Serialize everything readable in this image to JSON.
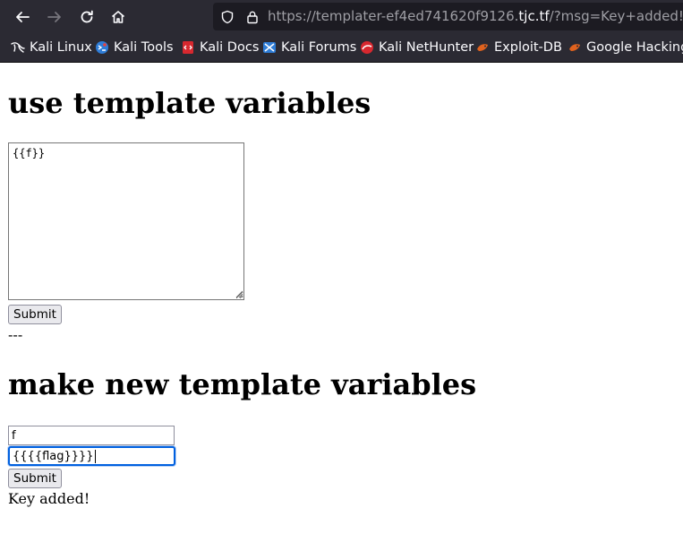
{
  "browser": {
    "url_prefix": "https://",
    "url_host_start": "templater-ef4ed741620f9126.",
    "url_host": "tjc.tf",
    "url_path": "/?msg=Key+added!",
    "bookmarks": [
      {
        "label": "Kali Linux",
        "icon": "kali-dragon-icon"
      },
      {
        "label": "Kali Tools",
        "icon": "kali-tools-icon"
      },
      {
        "label": "Kali Docs",
        "icon": "kali-docs-icon"
      },
      {
        "label": "Kali Forums",
        "icon": "kali-forums-icon"
      },
      {
        "label": "Kali NetHunter",
        "icon": "kali-nethunter-icon"
      },
      {
        "label": "Exploit-DB",
        "icon": "exploit-db-icon"
      },
      {
        "label": "Google Hacking",
        "icon": "google-hacking-icon"
      }
    ]
  },
  "page": {
    "heading1": "use template variables",
    "template_value": "{{f}}",
    "submit1_label": "Submit",
    "separator": "---",
    "heading2": "make new template variables",
    "key_value": "f",
    "value_value": "{{{{flag}}}}",
    "submit2_label": "Submit",
    "message": "Key added!"
  },
  "colors": {
    "chrome_bg": "#2b2a33",
    "urlbar_bg": "#1c1b22",
    "focus_ring": "#0060df"
  }
}
